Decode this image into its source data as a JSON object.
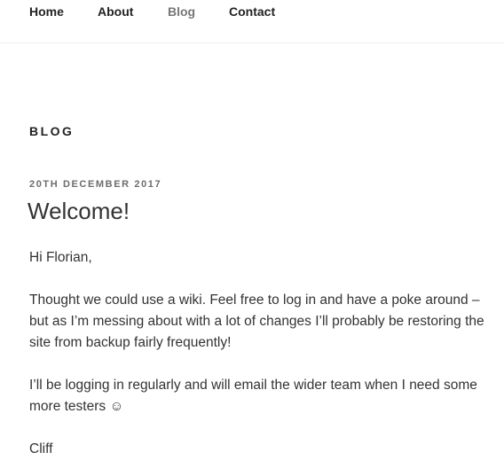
{
  "nav": {
    "items": [
      {
        "label": "Home"
      },
      {
        "label": "About"
      },
      {
        "label": "Blog"
      },
      {
        "label": "Contact"
      }
    ]
  },
  "section": {
    "title": "BLOG"
  },
  "post": {
    "date": "20TH DECEMBER 2017",
    "title": "Welcome!",
    "paragraphs": [
      "Hi Florian,",
      "Thought we could use a wiki.  Feel free to log in and have a poke around – but as I’m messing about with a lot of changes I’ll probably be restoring the site from backup fairly frequently!",
      "I’ll be logging in regularly and will email the wider team when I need some more testers ☺",
      "Cliff"
    ]
  }
}
